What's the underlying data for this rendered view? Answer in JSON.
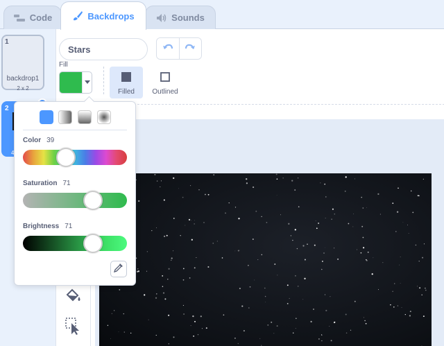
{
  "tabs": [
    {
      "label": "Code",
      "icon": "code-icon"
    },
    {
      "label": "Backdrops",
      "icon": "paintbrush-icon"
    },
    {
      "label": "Sounds",
      "icon": "speaker-icon"
    }
  ],
  "backdrops": [
    {
      "number": "1",
      "name": "backdrop1",
      "size": "2 x 2"
    },
    {
      "number": "2",
      "size": "48"
    }
  ],
  "editor": {
    "name_value": "Stars",
    "fill_label": "Fill",
    "fill_color": "#2fbb4e",
    "modes": {
      "filled": "Filled",
      "outlined": "Outlined"
    }
  },
  "color_picker": {
    "color_label": "Color",
    "color_value": "39",
    "saturation_label": "Saturation",
    "saturation_value": "71",
    "brightness_label": "Brightness",
    "brightness_value": "71",
    "gradient_options": [
      "solid",
      "horizontal",
      "vertical",
      "radial"
    ]
  },
  "colors": {
    "accent": "#4c97ff",
    "text": "#575e75"
  }
}
